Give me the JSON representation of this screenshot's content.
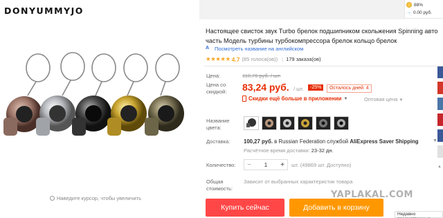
{
  "store": {
    "brand": "DONYUMMYJO"
  },
  "gallery": {
    "zoom_hint": "Наведите курсор, чтобы увеличить"
  },
  "side_panel": {
    "coins": "88%",
    "cashback": "0.00 руб."
  },
  "product": {
    "title": "Настоящее свисток звук Turbo брелок подшипником скольжения Spinning авто часть Модель турбины турбокомпрессора брелок кольцо брелок",
    "translate_link": "Посмотреть название на английском",
    "stars": "★★★★★",
    "rating": "4.7",
    "votes": "(85 голоса(ов))",
    "orders": "179 заказа(ов)"
  },
  "price": {
    "old_label": "Цена:",
    "old_value": "110,76 руб.",
    "old_unit": "/ шт.",
    "new_label": "Цена со скидкой:",
    "new_value": "83,24 руб.",
    "new_unit": "/ шт.",
    "discount": "-25%",
    "days_left": "Осталось дней: 4",
    "app_discount": "Скидки ещё больше в приложении",
    "wholesale": "Оптовая цена"
  },
  "options": {
    "color_label": "Название цвета:",
    "swatches": [
      "whistle-white",
      "black-1",
      "black-2",
      "black-3",
      "black-4",
      "black-5"
    ]
  },
  "delivery": {
    "label": "Доставка:",
    "price": "100,27 руб.",
    "to": "в Russian Federation службой",
    "service": "AliExpress Saver Shipping",
    "eta_label": "Расчётное время доставки:",
    "eta": "23-32 дн."
  },
  "quantity": {
    "label": "Количество:",
    "value": "1",
    "minus": "−",
    "plus": "+",
    "info": "шт. (49869 шт. Доступно)"
  },
  "total": {
    "label": "Общая стоимость:",
    "info": "Зависит от выбранных характеристик товара"
  },
  "actions": {
    "buy": "Купить сейчас",
    "cart": "Добавить в корзину"
  },
  "watermark": "YAPLAKAL.COM",
  "recently_viewed": "Недавно просмотренные",
  "colors": {
    "price_red": "#e62e04",
    "buy": "#ff4747",
    "cart": "#ff9800",
    "link": "#2e6bd6",
    "star": "#f6a623"
  }
}
